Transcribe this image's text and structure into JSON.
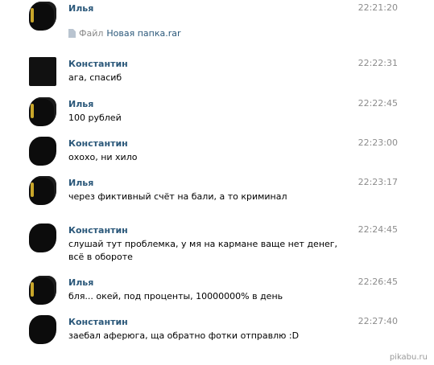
{
  "messages": [
    {
      "author": "Илья",
      "time": "22:21:20",
      "attachment": {
        "label": "Файл",
        "name": "Новая папка.rar"
      }
    },
    {
      "author": "Константин",
      "time": "22:22:31",
      "text": "ага, спасиб"
    },
    {
      "author": "Илья",
      "time": "22:22:45",
      "text": "100 рублей"
    },
    {
      "author": "Константин",
      "time": "22:23:00",
      "text": "охохо, ни хило"
    },
    {
      "author": "Илья",
      "time": "22:23:17",
      "text": "через фиктивный счёт на бали, а то криминал"
    },
    {
      "author": "Константин",
      "time": "22:24:45",
      "text": "слушай тут проблемка, у мя на кармане ваще нет денег, всё в обороте"
    },
    {
      "author": "Илья",
      "time": "22:26:45",
      "text": "бля... окей, под проценты, 10000000% в день"
    },
    {
      "author": "Константин",
      "time": "22:27:40",
      "text": "заебал аферюга, ща обратно фотки отправлю :D"
    }
  ],
  "watermark": "pikabu.ru",
  "colors": {
    "author": "#2b587a",
    "time": "#8c8c8c",
    "text": "#000000"
  }
}
